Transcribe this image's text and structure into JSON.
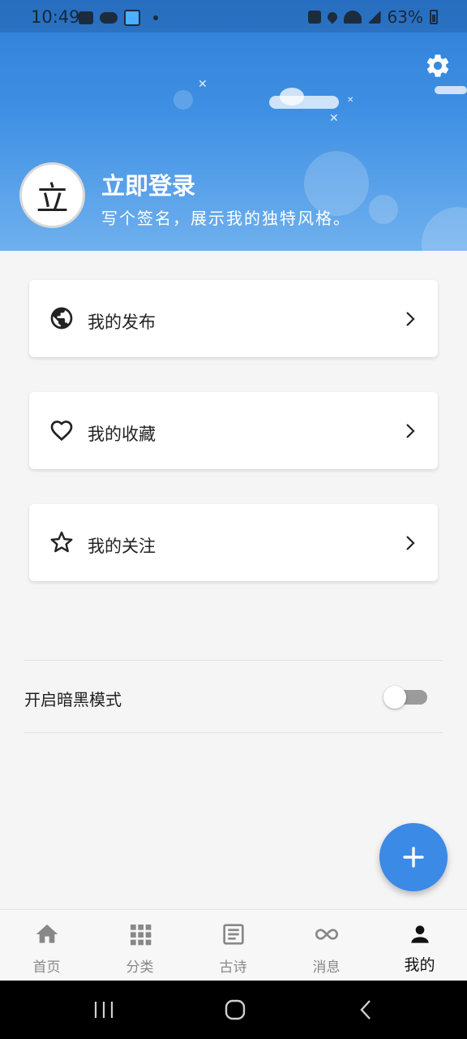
{
  "status_bar": {
    "time": "10:49",
    "battery": "63%",
    "icons": [
      "image-icon",
      "cat-icon",
      "home-wifi-icon",
      "dot-icon",
      "mute-icon",
      "location-icon",
      "wifi-icon",
      "signal-icon",
      "battery-icon"
    ]
  },
  "header": {
    "avatar_char": "立",
    "title": "立即登录",
    "subtitle": "写个签名，展示我的独特风格。",
    "settings_icon": "gear-icon"
  },
  "menu": {
    "items": [
      {
        "label": "我的发布",
        "icon": "globe-icon"
      },
      {
        "label": "我的收藏",
        "icon": "heart-icon"
      },
      {
        "label": "我的关注",
        "icon": "star-icon"
      }
    ]
  },
  "settings": {
    "dark_mode_label": "开启暗黑模式",
    "dark_mode_on": false
  },
  "fab": {
    "icon": "plus-icon"
  },
  "bottom_nav": {
    "items": [
      {
        "label": "首页",
        "icon": "home-icon"
      },
      {
        "label": "分类",
        "icon": "grid-icon"
      },
      {
        "label": "古诗",
        "icon": "article-icon"
      },
      {
        "label": "消息",
        "icon": "infinity-icon"
      },
      {
        "label": "我的",
        "icon": "person-icon",
        "active": true
      }
    ]
  },
  "colors": {
    "header_blue": "#3f90e4",
    "fab_blue": "#3b8ae6",
    "active_nav": "#111111",
    "inactive_nav": "#888888"
  }
}
